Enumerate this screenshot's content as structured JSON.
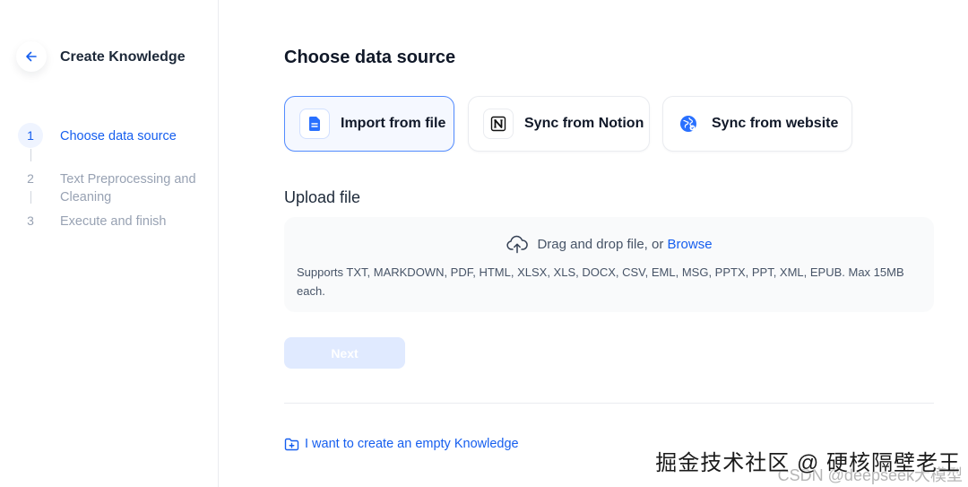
{
  "sidebar": {
    "title": "Create Knowledge",
    "steps": [
      {
        "num": "1",
        "label": "Choose data source"
      },
      {
        "num": "2",
        "label": "Text Preprocessing and Cleaning"
      },
      {
        "num": "3",
        "label": "Execute and finish"
      }
    ]
  },
  "main": {
    "title": "Choose data source",
    "sources": [
      {
        "label": "Import from file"
      },
      {
        "label": "Sync from Notion"
      },
      {
        "label": "Sync from website"
      }
    ],
    "upload": {
      "title": "Upload file",
      "drag_text": "Drag and drop file, or ",
      "browse_label": "Browse",
      "supports": "Supports TXT, MARKDOWN, PDF, HTML, XLSX, XLS, DOCX, CSV, EML, MSG, PPTX, PPT, XML, EPUB. Max 15MB each."
    },
    "next_label": "Next",
    "empty_link": "I want to create an empty Knowledge"
  },
  "watermark": {
    "main": "掘金技术社区 @ 硬核隔壁老王",
    "sub": "CSDN @deepseek大模型"
  }
}
